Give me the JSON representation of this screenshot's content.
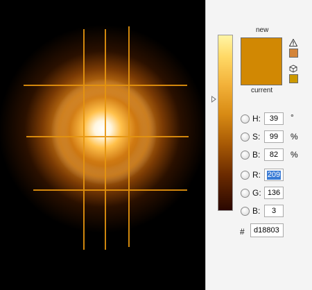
{
  "canvas": {
    "description_icon": "glowing-orb-with-guides"
  },
  "picker": {
    "new_label": "new",
    "current_label": "current",
    "new_color": "#d18803",
    "current_color": "#d18803",
    "warning_icon": "gamut-warning-icon",
    "websafe_icon": "websafe-cube-icon",
    "warning_swatch_color": "#d4853a",
    "websafe_swatch_color": "#cc9900",
    "fields": [
      {
        "label": "H:",
        "value": "39",
        "unit": "°"
      },
      {
        "label": "S:",
        "value": "99",
        "unit": "%"
      },
      {
        "label": "B:",
        "value": "82",
        "unit": "%"
      },
      {
        "label": "R:",
        "value": "209",
        "unit": ""
      },
      {
        "label": "G:",
        "value": "136",
        "unit": ""
      },
      {
        "label": "B:",
        "value": "3",
        "unit": ""
      }
    ],
    "hex_label": "#",
    "hex_value": "d18803"
  }
}
